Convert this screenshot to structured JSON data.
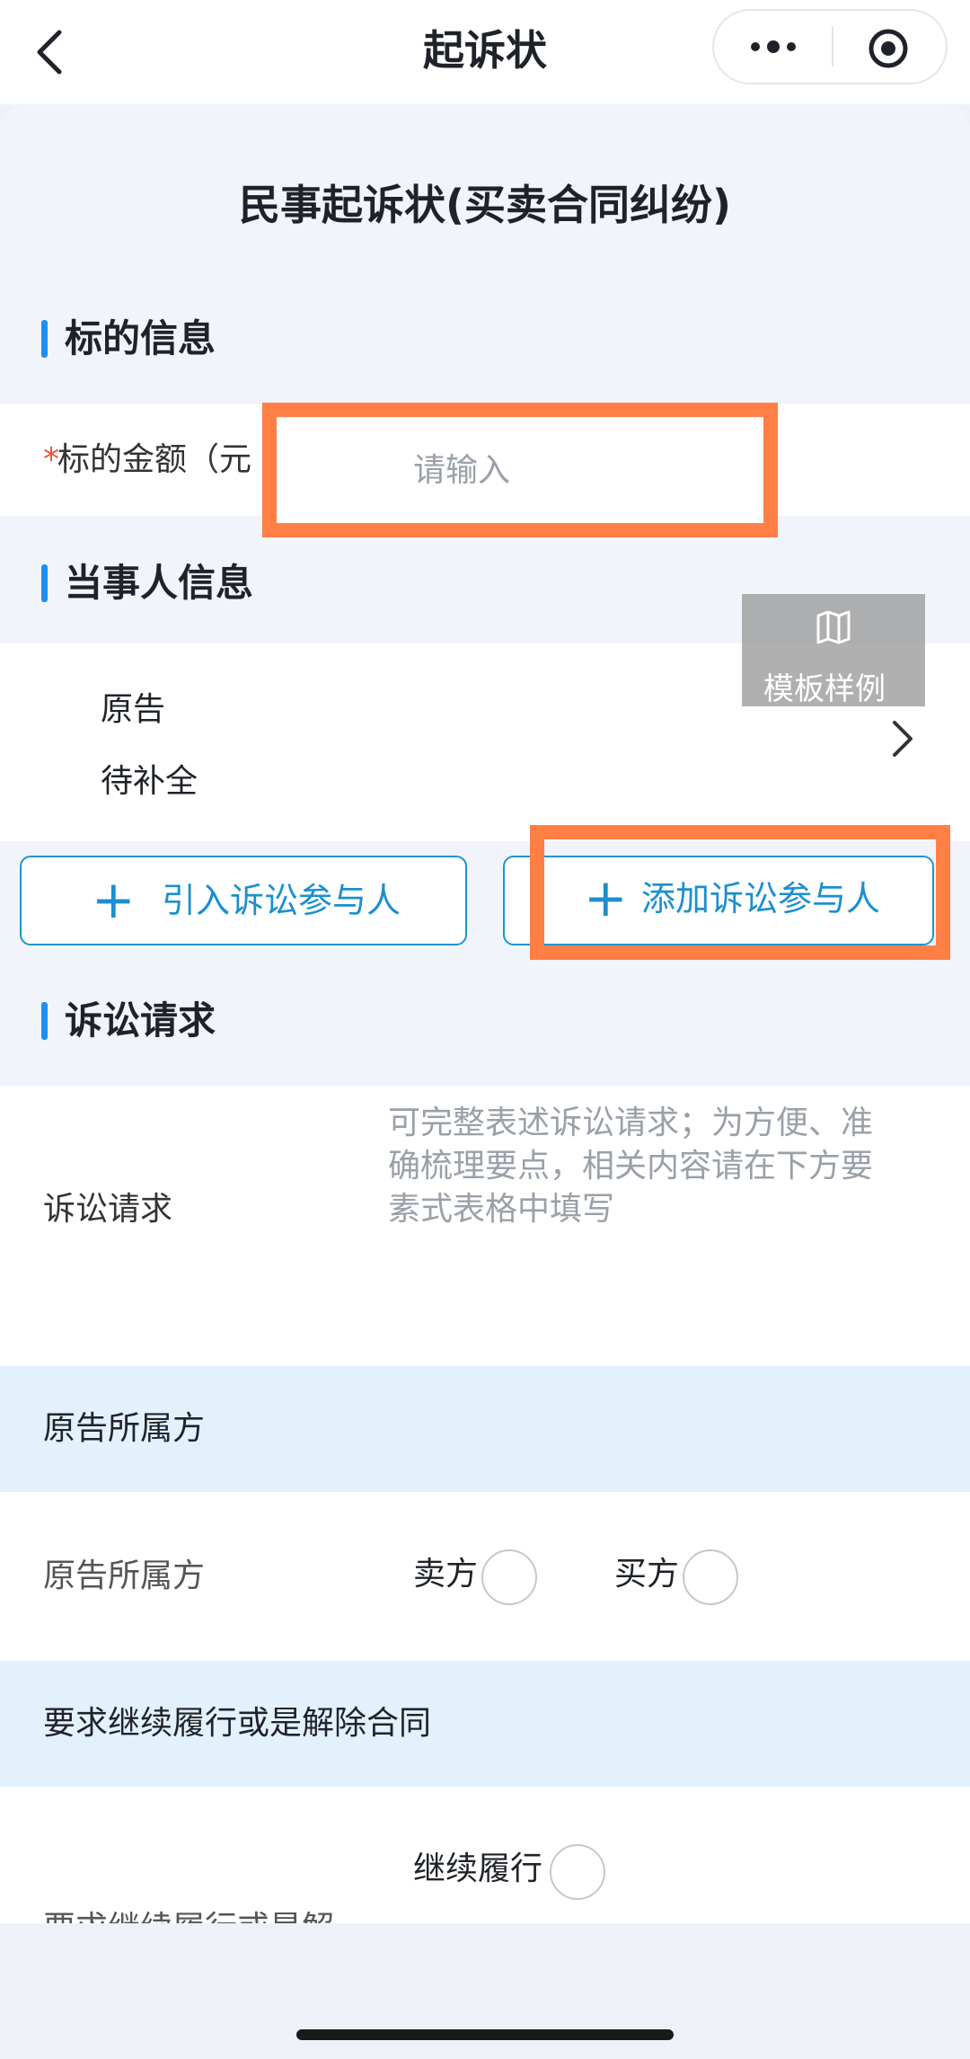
{
  "header": {
    "title": "起诉状"
  },
  "form": {
    "title": "民事起诉状(买卖合同纠纷)"
  },
  "subject_section": {
    "title": "标的信息",
    "required_mark": "*",
    "amount_label": "标的金额（元",
    "amount_placeholder": "请输入"
  },
  "party_section": {
    "title": "当事人信息",
    "template_label": "模板样例",
    "party_role": "原告",
    "party_status": "待补全",
    "import_button": "引入诉讼参与人",
    "add_button": "添加诉讼参与人",
    "plus_glyph": "+"
  },
  "claims_section": {
    "title": "诉讼请求",
    "claims_label": "诉讼请求",
    "claims_placeholder_line1": "可完整表述诉讼请求；为方便、准",
    "claims_placeholder_line2": "确梳理要点，相关内容请在下方要",
    "claims_placeholder_line3": "素式表格中填写"
  },
  "plaintiff_side": {
    "band_title": "原告所属方",
    "row_label": "原告所属方",
    "option_seller": "卖方",
    "option_buyer": "买方"
  },
  "contract_choice": {
    "band_title": "要求继续履行或是解除合同",
    "row_label": "要求继续履行或是解",
    "option_continue": "继续履行"
  },
  "colors": {
    "accent": "#1e8ff0",
    "highlight": "#ff7f45",
    "button_border": "#1b95d1"
  }
}
